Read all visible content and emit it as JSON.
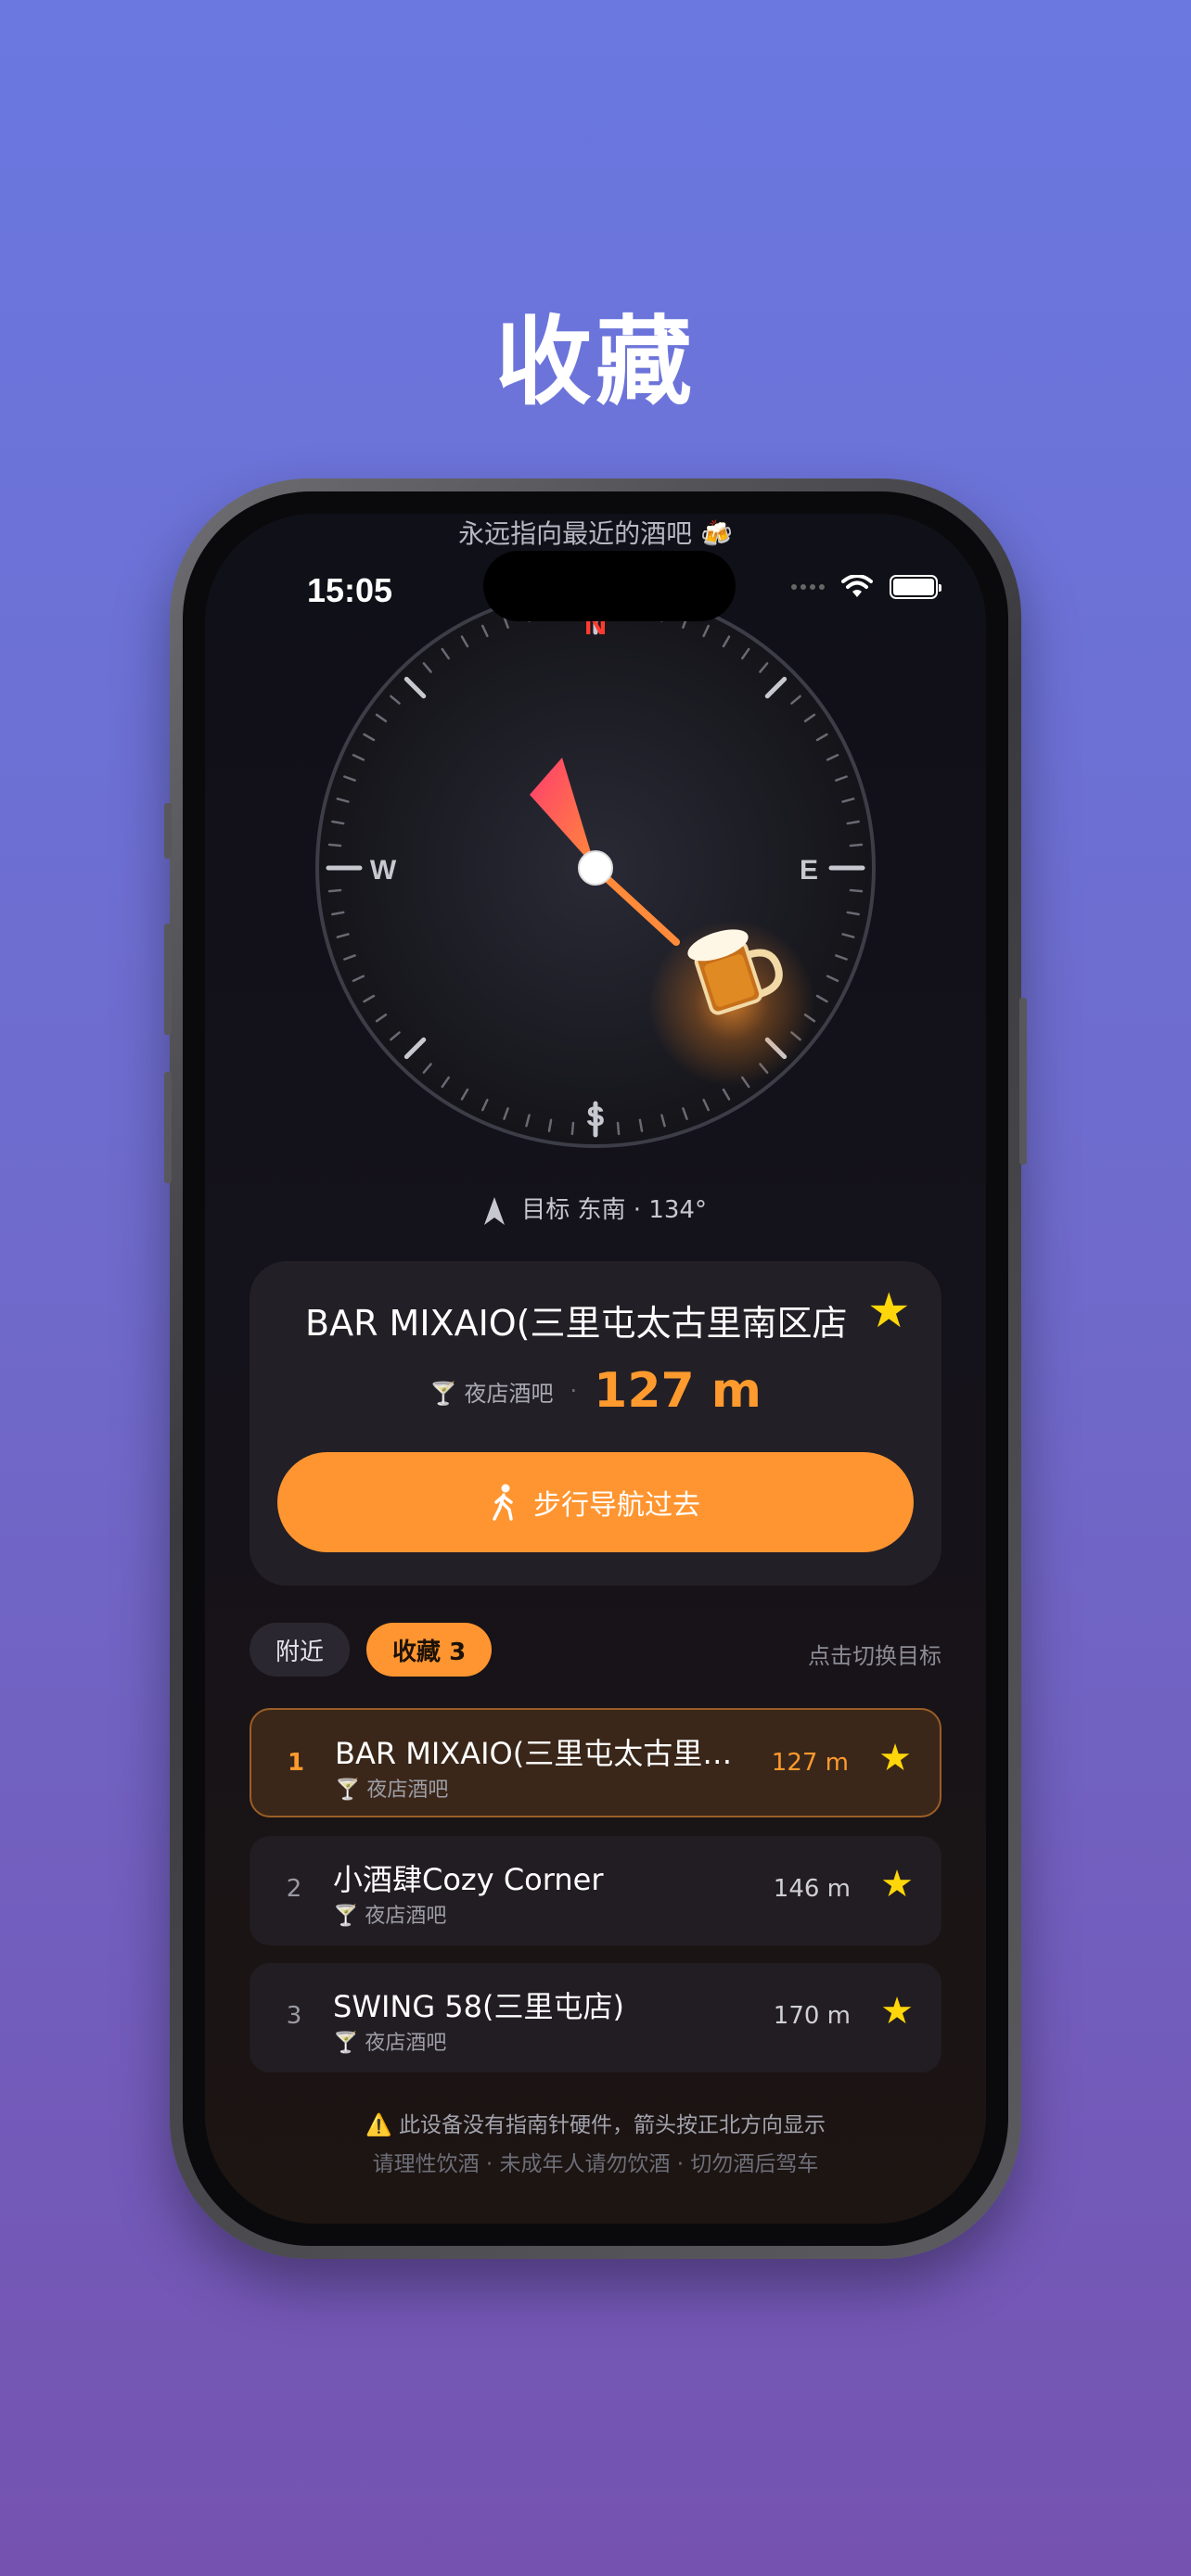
{
  "page": {
    "title": "收藏"
  },
  "app": {
    "tagline": "永远指向最近的酒吧 🍻"
  },
  "status_bar": {
    "time": "15:05"
  },
  "compass": {
    "north": "N",
    "east": "E",
    "south": "S",
    "west": "W",
    "target_label": "目标 东南 · 134°",
    "heading_degrees": 134,
    "target_icon": "beer-mug-icon"
  },
  "selected_bar": {
    "name": "BAR MIXAIO(三里屯太古里南区店",
    "category": "🍸 夜店酒吧",
    "separator": "·",
    "distance": "127 m",
    "favorited": true,
    "nav_button_label": "步行导航过去"
  },
  "tabs": [
    {
      "label": "附近",
      "active": false
    },
    {
      "label": "收藏 3",
      "active": true
    }
  ],
  "hint": "点击切换目标",
  "list": [
    {
      "rank": "1",
      "name": "BAR MIXAIO(三里屯太古里…",
      "category": "🍸 夜店酒吧",
      "distance": "127 m"
    },
    {
      "rank": "2",
      "name": "小酒肆Cozy Corner",
      "category": "🍸 夜店酒吧",
      "distance": "146 m"
    },
    {
      "rank": "3",
      "name": "SWING 58(三里屯店)",
      "category": "🍸 夜店酒吧",
      "distance": "170 m"
    }
  ],
  "footer": {
    "warning": "⚠️ 此设备没有指南针硬件，箭头按正北方向显示",
    "disclaimer": "请理性饮酒 · 未成年人请勿饮酒 · 切勿酒后驾车"
  },
  "colors": {
    "accent": "#ff9530",
    "star": "#ffd60a",
    "north": "#ff3b30"
  }
}
